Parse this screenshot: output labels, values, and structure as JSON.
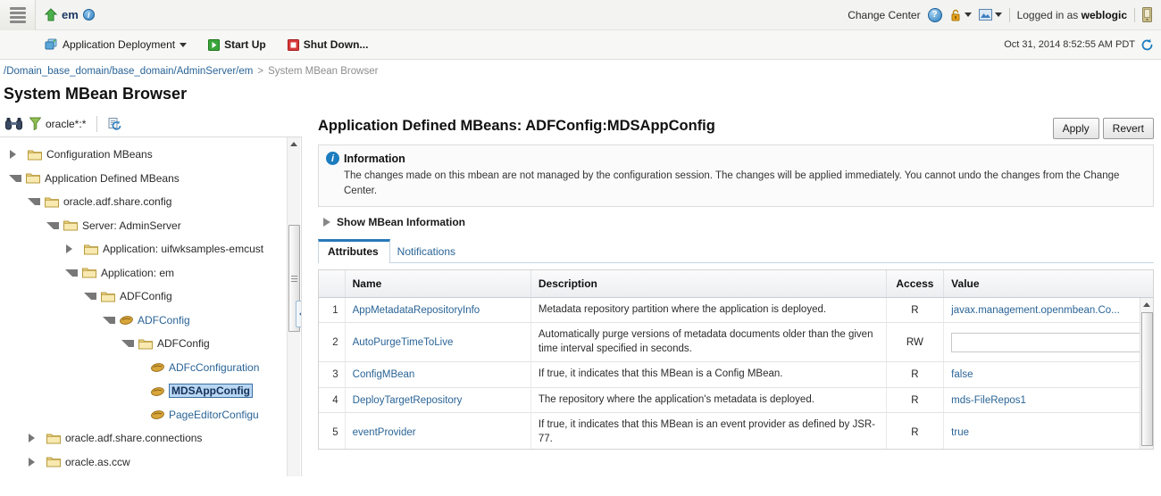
{
  "topbar": {
    "menu_icon": "hamburger-menu-icon",
    "brand_arrow_icon": "green-up-arrow-icon",
    "brand_name": "em",
    "brand_info_icon": "info-icon",
    "change_center_label": "Change Center",
    "help_icon": "help-icon",
    "lock_icon": "lock-icon",
    "picture_icon": "picture-icon",
    "logged_in_prefix": "Logged in as",
    "logged_in_user": "weblogic",
    "host_icon": "server-host-icon"
  },
  "actionbar": {
    "app_deployment_label": "Application Deployment",
    "app_deployment_icon": "application-deployment-icon",
    "startup_label": "Start Up",
    "startup_icon": "play-icon",
    "shutdown_label": "Shut Down...",
    "shutdown_icon": "stop-icon",
    "timestamp": "Oct 31, 2014 8:52:55 AM PDT",
    "refresh_icon": "refresh-icon"
  },
  "breadcrumb": {
    "path_link": "/Domain_base_domain/base_domain/AdminServer/em",
    "separator": ">",
    "current": "System MBean Browser"
  },
  "page": {
    "title": "System MBean Browser"
  },
  "tree_toolbar": {
    "search_icon": "binoculars-search-icon",
    "filter_icon": "funnel-filter-icon",
    "filter_value": "oracle*:*",
    "refresh_icon": "refresh-tree-icon"
  },
  "tree": {
    "nodes": [
      {
        "label": "Configuration MBeans",
        "indent": 0,
        "twist": "collapsed",
        "icon": "folder-icon",
        "type": "folder",
        "selected": false
      },
      {
        "label": "Application Defined MBeans",
        "indent": 0,
        "twist": "expanded",
        "icon": "folder-icon",
        "type": "folder",
        "selected": false
      },
      {
        "label": "oracle.adf.share.config",
        "indent": 1,
        "twist": "expanded",
        "icon": "folder-icon",
        "type": "folder",
        "selected": false
      },
      {
        "label": "Server: AdminServer",
        "indent": 2,
        "twist": "expanded",
        "icon": "folder-icon",
        "type": "folder",
        "selected": false
      },
      {
        "label": "Application: uifwksamples-emcust",
        "indent": 3,
        "twist": "collapsed",
        "icon": "folder-icon",
        "type": "folder",
        "selected": false
      },
      {
        "label": "Application: em",
        "indent": 3,
        "twist": "expanded",
        "icon": "folder-icon",
        "type": "folder",
        "selected": false
      },
      {
        "label": "ADFConfig",
        "indent": 4,
        "twist": "expanded",
        "icon": "folder-icon",
        "type": "folder",
        "selected": false
      },
      {
        "label": "ADFConfig",
        "indent": 5,
        "twist": "expanded",
        "icon": "bean-icon",
        "type": "bean",
        "selected": false
      },
      {
        "label": "ADFConfig",
        "indent": 6,
        "twist": "expanded",
        "icon": "folder-icon",
        "type": "folder",
        "selected": false
      },
      {
        "label": "ADFcConfiguration",
        "indent": 7,
        "twist": "none",
        "icon": "bean-icon",
        "type": "bean",
        "selected": false
      },
      {
        "label": "MDSAppConfig",
        "indent": 7,
        "twist": "none",
        "icon": "bean-icon",
        "type": "bean",
        "selected": true
      },
      {
        "label": "PageEditorConfigu",
        "indent": 7,
        "twist": "none",
        "icon": "bean-icon",
        "type": "bean",
        "selected": false
      },
      {
        "label": "oracle.adf.share.connections",
        "indent": 1,
        "twist": "collapsed",
        "icon": "folder-icon",
        "type": "folder",
        "selected": false
      },
      {
        "label": "oracle.as.ccw",
        "indent": 1,
        "twist": "collapsed",
        "icon": "folder-icon",
        "type": "folder",
        "selected": false
      }
    ]
  },
  "content": {
    "title": "Application Defined MBeans: ADFConfig:MDSAppConfig",
    "apply_label": "Apply",
    "revert_label": "Revert",
    "info": {
      "icon": "info-icon",
      "title": "Information",
      "body": "The changes made on this mbean are not managed by the configuration session. The changes will be applied immediately. You cannot undo the changes from the Change Center."
    },
    "show_mbean_label": "Show MBean Information",
    "show_mbean_icon": "disclosure-triangle-icon",
    "tabs": [
      {
        "label": "Attributes",
        "active": true
      },
      {
        "label": "Notifications",
        "active": false
      }
    ],
    "table": {
      "columns": [
        "",
        "Name",
        "Description",
        "Access",
        "Value"
      ],
      "rows": [
        {
          "num": "1",
          "name": "AppMetadataRepositoryInfo",
          "description": "Metadata repository partition where the application is deployed.",
          "access": "R",
          "value": "javax.management.openmbean.Co...",
          "value_type": "link"
        },
        {
          "num": "2",
          "name": "AutoPurgeTimeToLive",
          "description": "Automatically purge versions of metadata documents older than the given time interval specified in seconds.",
          "access": "RW",
          "value": "",
          "value_type": "input"
        },
        {
          "num": "3",
          "name": "ConfigMBean",
          "description": "If true, it indicates that this MBean is a Config MBean.",
          "access": "R",
          "value": "false",
          "value_type": "link"
        },
        {
          "num": "4",
          "name": "DeployTargetRepository",
          "description": "The repository where the application's metadata is deployed.",
          "access": "R",
          "value": "mds-FileRepos1",
          "value_type": "link"
        },
        {
          "num": "5",
          "name": "eventProvider",
          "description": "If true, it indicates that this MBean is an event provider as defined by JSR-77.",
          "access": "R",
          "value": "true",
          "value_type": "link"
        }
      ]
    }
  },
  "colors": {
    "link": "#2a6496",
    "accent": "#2779b8",
    "info": "#1b7cc0",
    "selection_bg": "#b9d7f2",
    "folder": "#e8c96a",
    "bean": "#c9952f",
    "green": "#3aa53a",
    "red": "#d93a3a"
  }
}
